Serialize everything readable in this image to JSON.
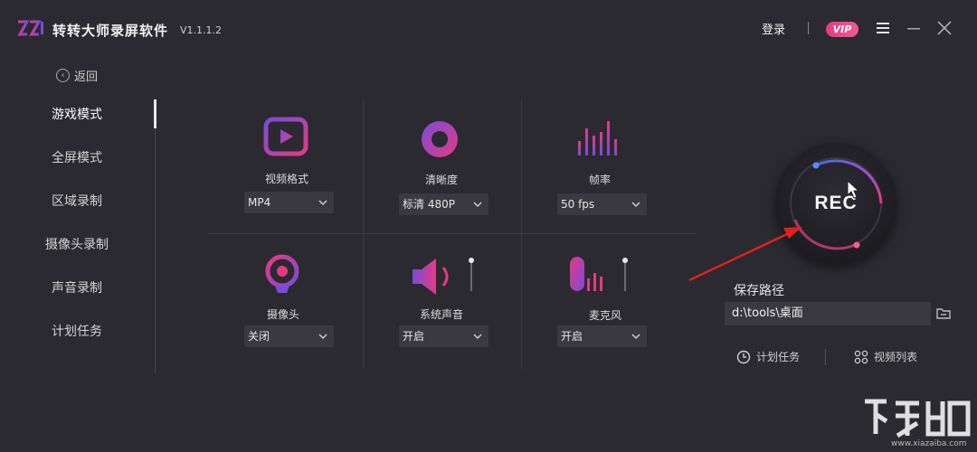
{
  "titlebar": {
    "title": "转转大师录屏软件",
    "version": "V1.1.1.2",
    "login": "登录",
    "vip": "VIP"
  },
  "sidebar": {
    "back": "返回",
    "items": [
      {
        "label": "游戏模式",
        "active": true
      },
      {
        "label": "全屏模式"
      },
      {
        "label": "区域录制"
      },
      {
        "label": "摄像头录制"
      },
      {
        "label": "声音录制"
      },
      {
        "label": "计划任务"
      }
    ]
  },
  "settings": {
    "video_format": {
      "label": "视频格式",
      "value": "MP4"
    },
    "clarity": {
      "label": "清晰度",
      "value": "标清 480P"
    },
    "framerate": {
      "label": "帧率",
      "value": "50 fps"
    },
    "camera": {
      "label": "摄像头",
      "value": "关闭"
    },
    "system_audio": {
      "label": "系统声音",
      "value": "开启"
    },
    "microphone": {
      "label": "麦克风",
      "value": "开启"
    }
  },
  "rec": {
    "label": "REC"
  },
  "save": {
    "label": "保存路径",
    "path": "d:\\tools\\桌面"
  },
  "footer": {
    "schedule": "计划任务",
    "video_list": "视频列表"
  },
  "watermark": {
    "text": "www.xiazaiba.com"
  },
  "colors": {
    "accent_pink": "#e33a84",
    "accent_purple": "#7b4bd8",
    "background": "#2b2a30",
    "arrow": "#e02020"
  }
}
